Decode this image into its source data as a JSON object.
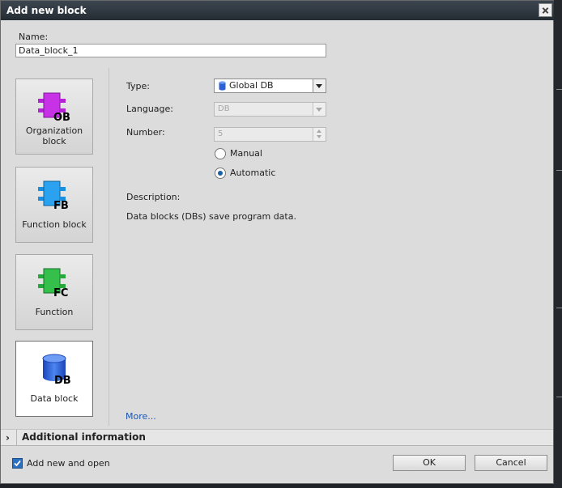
{
  "dialog": {
    "title": "Add new block"
  },
  "name": {
    "label": "Name:",
    "value": "Data_block_1"
  },
  "blocks": [
    {
      "label": "Organization block",
      "icon_text": "OB",
      "icon": "organization-block-icon",
      "color": "#b522d6",
      "selected": false
    },
    {
      "label": "Function block",
      "icon_text": "FB",
      "icon": "function-block-icon",
      "color": "#1a8fe0",
      "selected": false
    },
    {
      "label": "Function",
      "icon_text": "FC",
      "icon": "function-icon",
      "color": "#27a83a",
      "selected": false
    },
    {
      "label": "Data block",
      "icon_text": "DB",
      "icon": "data-block-icon",
      "color": "#2a5fd6",
      "selected": true
    }
  ],
  "form": {
    "type_label": "Type:",
    "type_value": "Global DB",
    "language_label": "Language:",
    "language_value": "DB",
    "number_label": "Number:",
    "number_value": "5",
    "manual_label": "Manual",
    "automatic_label": "Automatic",
    "selected_mode": "Automatic"
  },
  "description": {
    "label": "Description:",
    "text": "Data blocks (DBs) save program data."
  },
  "more_link": "More...",
  "additional_info": {
    "title": "Additional  information"
  },
  "footer": {
    "checkbox_label": "Add new and open",
    "checkbox_checked": true,
    "ok": "OK",
    "cancel": "Cancel"
  }
}
